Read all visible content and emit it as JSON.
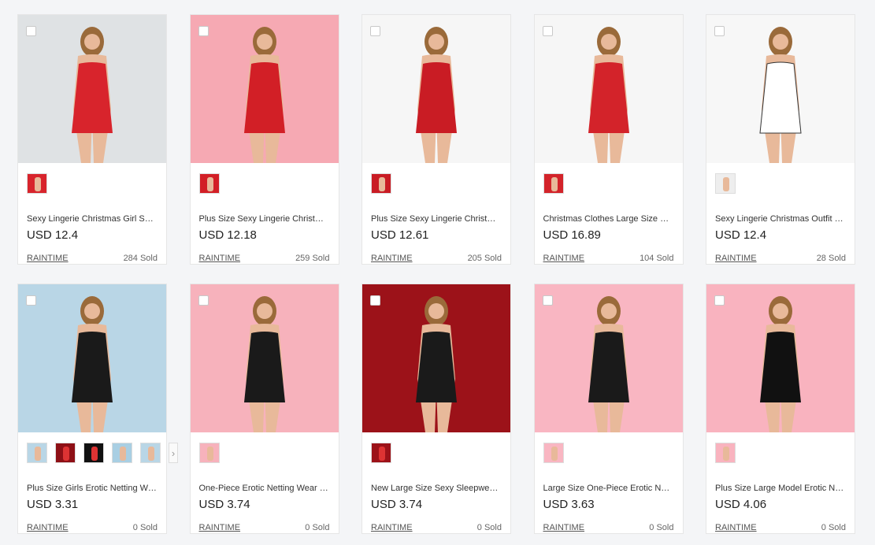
{
  "products": [
    {
      "title": "Sexy Lingerie Christmas Girl Short Skirt Cosplay Set",
      "price": "USD 12.4",
      "store": "RAINTIME",
      "sold": "284 Sold",
      "bg": "#dfe2e4",
      "outfit": "#d8242c",
      "thumbs": [
        "#d8242c"
      ]
    },
    {
      "title": "Plus Size Sexy Lingerie Christmas Dress",
      "price": "USD 12.18",
      "store": "RAINTIME",
      "sold": "259 Sold",
      "bg": "#f6a9b3",
      "outfit": "#d21f26",
      "thumbs": [
        "#d21f26"
      ]
    },
    {
      "title": "Plus Size Sexy Lingerie Christmas Costume",
      "price": "USD 12.61",
      "store": "RAINTIME",
      "sold": "205 Sold",
      "bg": "#f6f6f6",
      "outfit": "#c91c24",
      "thumbs": [
        "#c91c24"
      ]
    },
    {
      "title": "Christmas Clothes Large Size Sexy Dress",
      "price": "USD 16.89",
      "store": "RAINTIME",
      "sold": "104 Sold",
      "bg": "#f6f6f6",
      "outfit": "#d3232a",
      "thumbs": [
        "#d3232a"
      ]
    },
    {
      "title": "Sexy Lingerie Christmas Outfit plus size",
      "price": "USD 12.4",
      "store": "RAINTIME",
      "sold": "28 Sold",
      "bg": "#f7f7f7",
      "outfit": "#ffffff",
      "thumbs": [
        "#eeeeee"
      ]
    },
    {
      "title": "Plus Size Girls Erotic Netting Wear Bodystocking",
      "price": "USD 3.31",
      "store": "RAINTIME",
      "sold": "0 Sold",
      "bg": "#b9d6e6",
      "outfit": "#1a1a1a",
      "thumbs": [
        "#b9d6e6",
        "#8e1016",
        "#111111",
        "#a9cfe3",
        "#b9d6e6"
      ]
    },
    {
      "title": "One-Piece Erotic Netting Wear Bodystocking",
      "price": "USD 3.74",
      "store": "RAINTIME",
      "sold": "0 Sold",
      "bg": "#f7b2bc",
      "outfit": "#1a1a1a",
      "thumbs": [
        "#f7b2bc"
      ]
    },
    {
      "title": "New Large Size Sexy Sleepwear Netting",
      "price": "USD 3.74",
      "store": "RAINTIME",
      "sold": "0 Sold",
      "bg": "#9c1219",
      "outfit": "#1a1a1a",
      "thumbs": [
        "#9c1219"
      ]
    },
    {
      "title": "Large Size One-Piece Erotic Netting",
      "price": "USD 3.63",
      "store": "RAINTIME",
      "sold": "0 Sold",
      "bg": "#f9b6c2",
      "outfit": "#1a1a1a",
      "thumbs": [
        "#f9b6c2"
      ]
    },
    {
      "title": "Plus Size Large Model Erotic Netting Dress",
      "price": "USD 4.06",
      "store": "RAINTIME",
      "sold": "0 Sold",
      "bg": "#f9b3bf",
      "outfit": "#111111",
      "thumbs": [
        "#f9b3bf"
      ]
    }
  ],
  "skin_color": "#e8b99a",
  "hair_color": "#9a6a3a"
}
